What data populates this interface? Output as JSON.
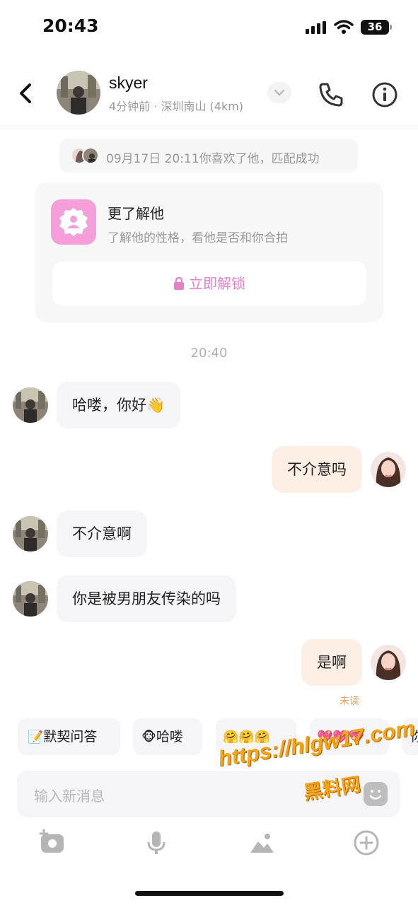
{
  "status_bar": {
    "time": "20:43",
    "battery": "36"
  },
  "header": {
    "name": "skyer",
    "subtitle": "4分钟前 · 深圳南山 (4km)"
  },
  "match_notice": {
    "text": "09月17日 20:11你喜欢了他，匹配成功"
  },
  "know_card": {
    "title": "更了解他",
    "description": "了解他的性格，看他是否和你合拍",
    "unlock_label": "立即解锁",
    "accent": "#e580c9"
  },
  "time_label": "20:40",
  "messages": [
    {
      "from": "other",
      "text": "哈喽，你好👋"
    },
    {
      "from": "me",
      "text": "不介意吗"
    },
    {
      "from": "other",
      "text": "不介意啊"
    },
    {
      "from": "other",
      "text": "你是被男朋友传染的吗"
    },
    {
      "from": "me",
      "text": "是啊"
    }
  ],
  "read_status": "未读",
  "quick_replies": [
    {
      "icon": "📝",
      "label": "默契问答"
    },
    {
      "icon": "🐵",
      "label": "哈喽"
    },
    {
      "icon": "🤗🤗🤗",
      "label": ""
    },
    {
      "icon": "💖💖💖",
      "label": ""
    },
    {
      "icon": "",
      "label": "你"
    }
  ],
  "input": {
    "placeholder": "输入新消息"
  },
  "watermark": {
    "url": "https://hlgw17.com",
    "brand": "黑料网"
  }
}
